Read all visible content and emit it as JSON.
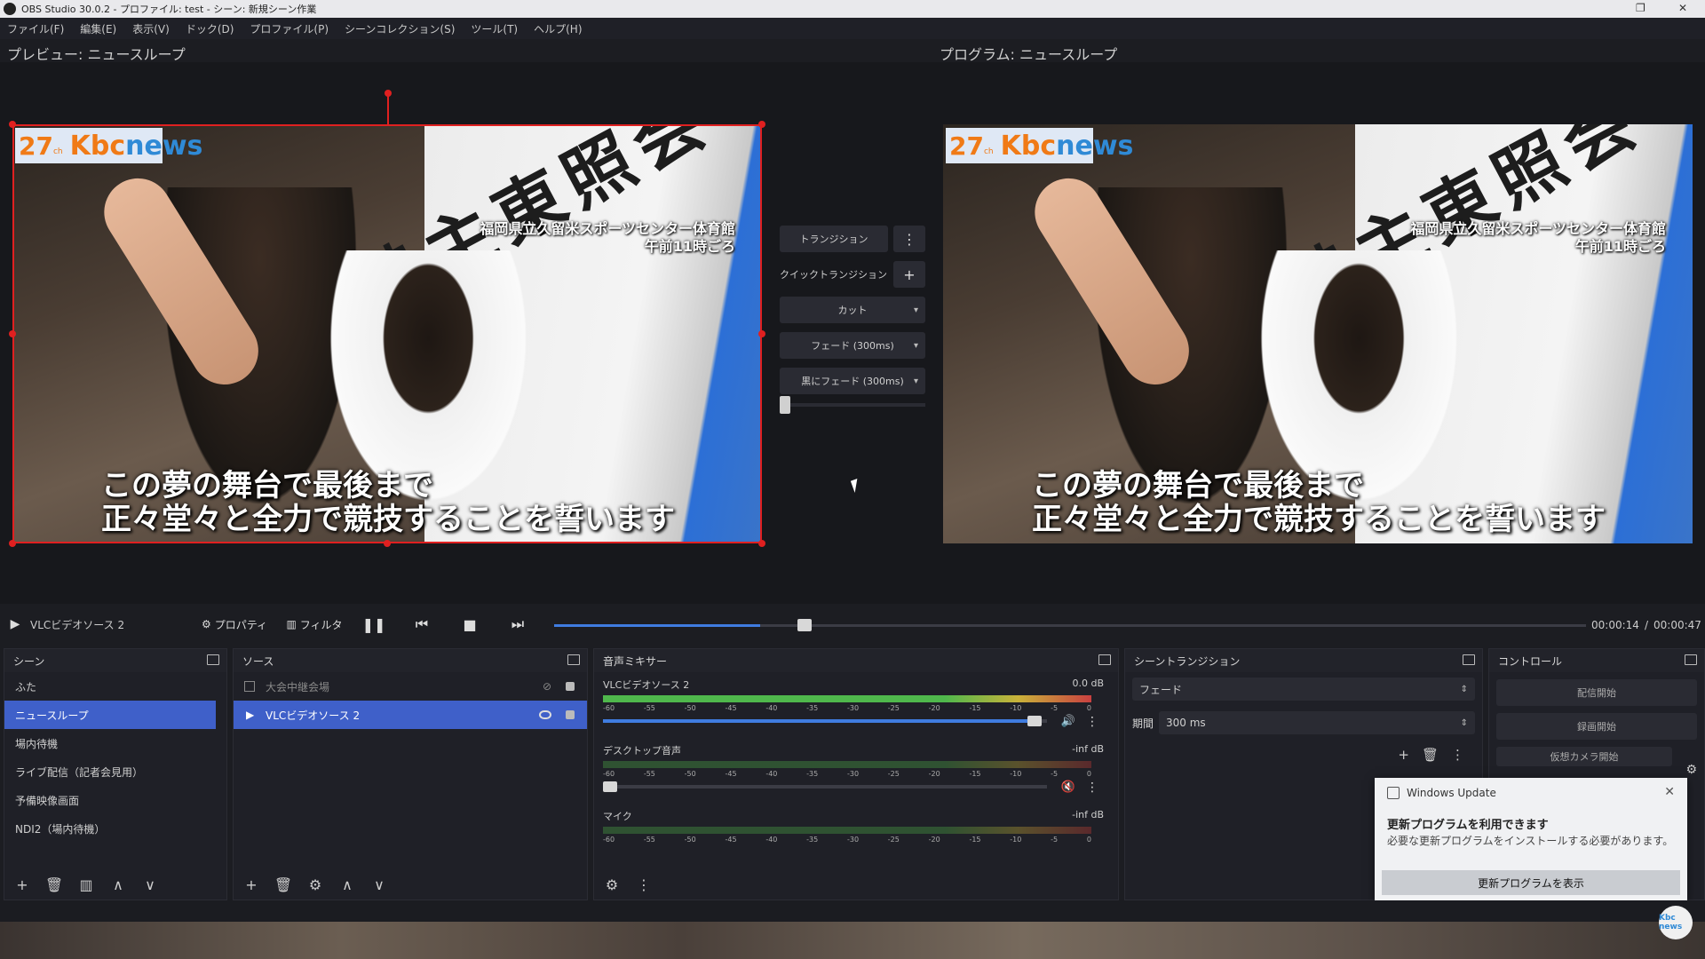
{
  "window": {
    "title": "OBS Studio 30.0.2 - プロファイル: test - シーン: 新規シーン作業"
  },
  "menu": [
    "ファイル(F)",
    "編集(E)",
    "表示(V)",
    "ドック(D)",
    "プロファイル(P)",
    "シーンコレクション(S)",
    "ツール(T)",
    "ヘルプ(H)"
  ],
  "preview": {
    "label": "プレビュー: ニュースループ"
  },
  "program": {
    "label": "プログラム: ニュースループ"
  },
  "video": {
    "logo_num": "27",
    "logo_sub": "ch",
    "logo_kbc": "Kbc",
    "logo_news": "news",
    "location_line1": "福岡県立久留米スポーツセンター体育館",
    "location_line2": "午前11時ごろ",
    "caption_line1": "この夢の舞台で最後まで",
    "caption_line2": "正々堂々と全力で競技することを誓います",
    "flag_text": "勢主東照会"
  },
  "transition_panel": {
    "transition_label": "トランジション",
    "quick_label": "クイックトランジション",
    "cut_label": "カット",
    "fade_label": "フェード (300ms)",
    "fade_black_label": "黒にフェード (300ms)"
  },
  "media": {
    "source_name": "VLCビデオソース 2",
    "properties_label": "プロパティ",
    "filters_label": "フィルタ",
    "current_time": "00:00:14",
    "separator": "/",
    "total_time": "00:00:47",
    "progress": 0.2
  },
  "scenes": {
    "title": "シーン",
    "items": [
      "ふた",
      "ニュースループ",
      "場内待機",
      "ライブ配信（記者会見用）",
      "予備映像画面",
      "NDI2（場内待機）"
    ],
    "selected_index": 1
  },
  "sources": {
    "title": "ソース",
    "items": [
      {
        "name": "大会中継会場",
        "visible": false
      },
      {
        "name": "VLCビデオソース 2",
        "visible": true
      }
    ]
  },
  "mixer": {
    "title": "音声ミキサー",
    "scale": [
      "-60",
      "-55",
      "-50",
      "-45",
      "-40",
      "-35",
      "-30",
      "-25",
      "-20",
      "-15",
      "-10",
      "-5",
      "0"
    ],
    "channels": [
      {
        "name": "VLCビデオソース 2",
        "db": "0.0 dB",
        "volume": 0.98,
        "muted": false
      },
      {
        "name": "デスクトップ音声",
        "db": "-inf dB",
        "volume": 0.0,
        "muted": true
      },
      {
        "name": "マイク",
        "db": "-inf dB",
        "volume": 0.0,
        "muted": true
      }
    ]
  },
  "scene_transitions": {
    "title": "シーントランジション",
    "type": "フェード",
    "duration_label": "期間",
    "duration_value": "300 ms"
  },
  "controls": {
    "title": "コントロール",
    "buttons": [
      "配信開始",
      "録画開始",
      "仮想カメラ開始"
    ]
  },
  "notification": {
    "app": "Windows Update",
    "title": "更新プログラムを利用できます",
    "body": "必要な更新プログラムをインストールする必要があります。",
    "action": "更新プログラムを表示"
  },
  "badge": {
    "text": "Kbc news"
  },
  "colors": {
    "accent": "#3f60c9",
    "selection": "#e02020",
    "brand_orange": "#f07a16",
    "brand_blue": "#2f8ad6"
  }
}
